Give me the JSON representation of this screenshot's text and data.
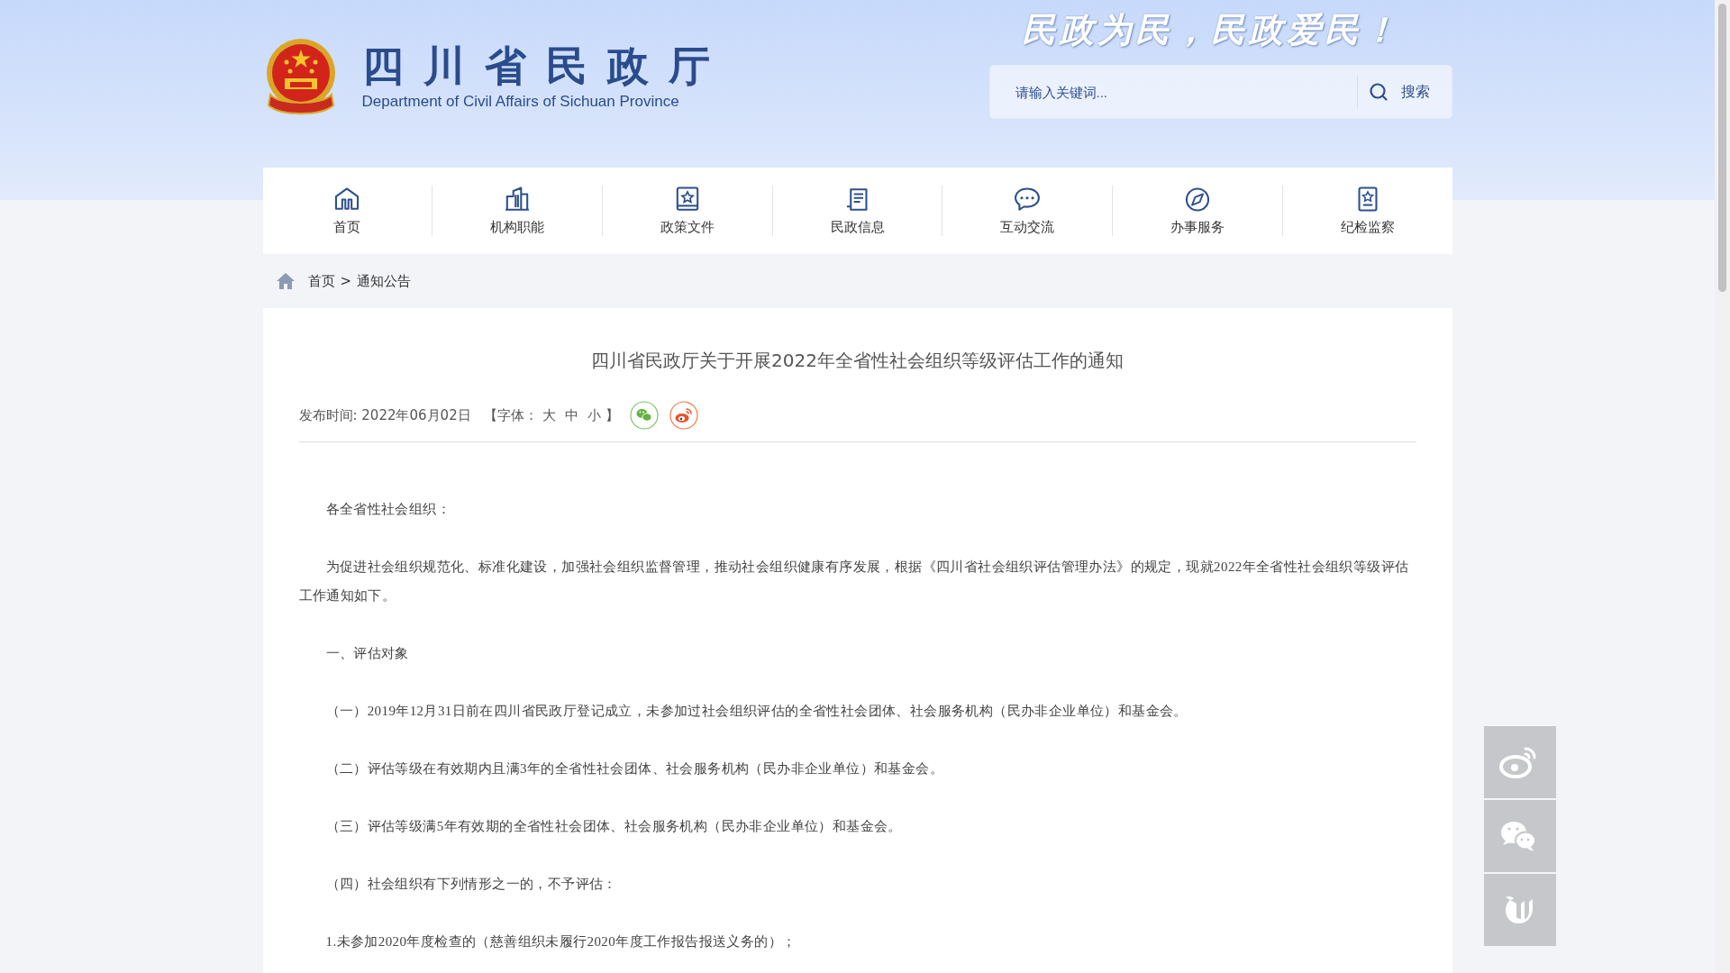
{
  "header": {
    "title": "四川省民政厅",
    "subtitle": "Department of Civil Affairs of Sichuan Province",
    "slogan": "民政为民，民政爱民！",
    "search": {
      "placeholder": "请输入关键词...",
      "button": "搜索"
    }
  },
  "nav": [
    {
      "label": "首页",
      "kind": "home"
    },
    {
      "label": "机构职能",
      "kind": "building"
    },
    {
      "label": "政策文件",
      "kind": "book"
    },
    {
      "label": "民政信息",
      "kind": "scroll"
    },
    {
      "label": "互动交流",
      "kind": "chat"
    },
    {
      "label": "办事服务",
      "kind": "compass"
    },
    {
      "label": "纪检监察",
      "kind": "badge"
    }
  ],
  "breadcrumb": {
    "items": [
      "首页",
      "通知公告"
    ],
    "separator": ">"
  },
  "article": {
    "title": "四川省民政厅关于开展2022年全省性社会组织等级评估工作的通知",
    "published": "发布时间: 2022年06月02日",
    "font_label": "【字体：",
    "font_sizes": [
      "大",
      "中",
      "小"
    ],
    "font_end": "】",
    "share": [
      {
        "kind": "wechat"
      },
      {
        "kind": "weibo"
      }
    ],
    "paragraphs": [
      "各全省性社会组织：",
      "为促进社会组织规范化、标准化建设，加强社会组织监督管理，推动社会组织健康有序发展，根据《四川省社会组织评估管理办法》的规定，现就2022年全省性社会组织等级评估工作通知如下。",
      "一、评估对象",
      "（一）2019年12月31日前在四川省民政厅登记成立，未参加过社会组织评估的全省性社会团体、社会服务机构（民办非企业单位）和基金会。",
      "（二）评估等级在有效期内且满3年的全省性社会团体、社会服务机构（民办非企业单位）和基金会。",
      "（三）评估等级满5年有效期的全省性社会团体、社会服务机构（民办非企业单位）和基金会。",
      "（四）社会组织有下列情形之一的，不予评估：",
      "1.未参加2020年度检查的（慈善组织未履行2020年度工作报告报送义务的）；"
    ]
  },
  "side_links": [
    {
      "kind": "weibo"
    },
    {
      "kind": "wechat"
    },
    {
      "kind": "app"
    }
  ]
}
